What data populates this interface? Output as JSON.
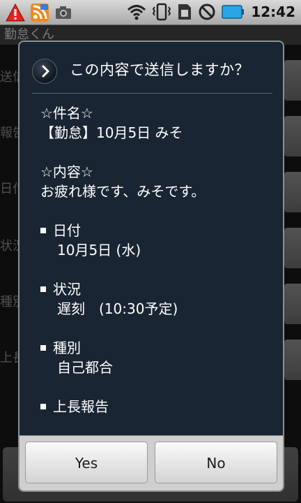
{
  "statusbar": {
    "time": "12:42",
    "icons": [
      "warning-icon",
      "rss-icon",
      "camera-icon",
      "wifi-icon",
      "vibrate-icon",
      "sim-icon",
      "no-sim-icon",
      "battery-icon"
    ]
  },
  "app": {
    "title": "勤怠くん",
    "labels": [
      "送信",
      "報告",
      "日付",
      "状況",
      "種別",
      "上長"
    ]
  },
  "dialog": {
    "title": "この内容で送信しますか？",
    "subject_header": "☆件名☆",
    "subject": "【勤怠】10月5日 みそ",
    "content_header": "☆内容☆",
    "content": "お疲れ様です、みそです。",
    "fields": [
      {
        "label": "日付",
        "value": "10月5日 (水)"
      },
      {
        "label": "状況",
        "value": "遅刻　(10:30予定)"
      },
      {
        "label": "種別",
        "value": "自己都合"
      },
      {
        "label": "上長報告",
        "value": ""
      }
    ],
    "yes_label": "Yes",
    "no_label": "No"
  },
  "colors": {
    "dialog_bg": "#1a2533",
    "footer_bg": "#cfcfcf",
    "text": "#ffffff",
    "warning": "#e8211b",
    "rss": "#f08a1c",
    "battery": "#2aa6e6"
  }
}
